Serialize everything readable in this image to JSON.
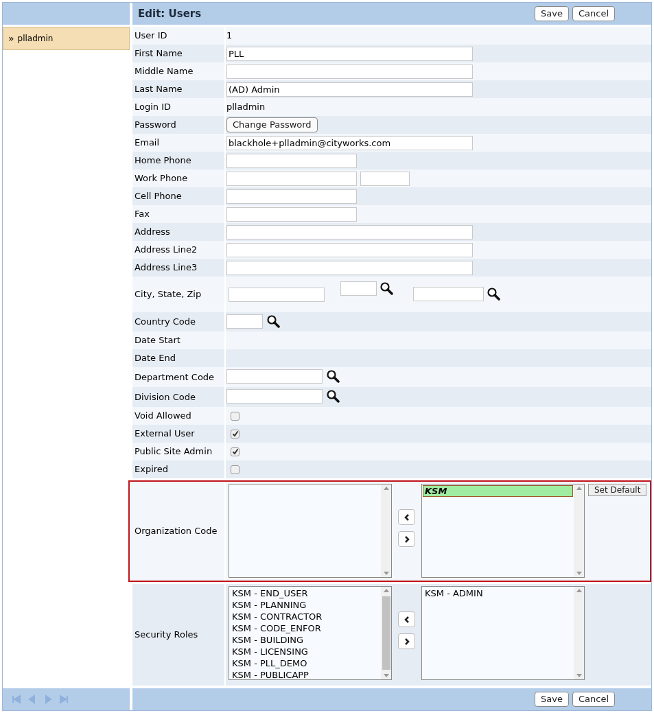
{
  "sidebar": {
    "items": [
      {
        "icon": "»",
        "label": "plladmin",
        "selected": true
      }
    ]
  },
  "header": {
    "title": "Edit: Users",
    "buttons": [
      "Save",
      "Cancel"
    ]
  },
  "fields": [
    {
      "label": "User ID",
      "kind": "text",
      "value": "1"
    },
    {
      "label": "First Name",
      "kind": "input_wide",
      "value": "PLL"
    },
    {
      "label": "Middle Name",
      "kind": "input_wide"
    },
    {
      "label": "Last Name",
      "kind": "input_wide",
      "value": "(AD) Admin"
    },
    {
      "label": "Login ID",
      "kind": "text",
      "value": "plladmin"
    },
    {
      "label": "Password",
      "kind": "button",
      "button": "Change Password"
    },
    {
      "label": "Email",
      "kind": "input_wide",
      "value": "blackhole+plladmin@cityworks.com"
    },
    {
      "label": "Home Phone",
      "kind": "input_short"
    },
    {
      "label": "Work Phone",
      "kind": "phone_ext"
    },
    {
      "label": "Cell Phone",
      "kind": "input_short"
    },
    {
      "label": "Fax",
      "kind": "input_short"
    },
    {
      "label": "Address",
      "kind": "input_wide"
    },
    {
      "label": "Address Line2",
      "kind": "input_wide"
    },
    {
      "label": "Address Line3",
      "kind": "input_wide"
    },
    {
      "label": "City, State, Zip",
      "kind": "city_state_zip"
    },
    {
      "label": "Country Code",
      "kind": "lookup_small"
    },
    {
      "label": "Date Start",
      "kind": "empty"
    },
    {
      "label": "Date End",
      "kind": "empty"
    },
    {
      "label": "Department Code",
      "kind": "lookup"
    },
    {
      "label": "Division Code",
      "kind": "lookup"
    },
    {
      "label": "Void Allowed",
      "kind": "checkbox",
      "checked": false
    },
    {
      "label": "External User",
      "kind": "checkbox",
      "checked": true
    },
    {
      "label": "Public Site Admin",
      "kind": "checkbox",
      "checked": true
    },
    {
      "label": "Expired",
      "kind": "checkbox",
      "checked": false
    },
    {
      "label": "Organization Code",
      "kind": "dual_list",
      "highlighted": true,
      "chosen": [
        {
          "label": "KSM",
          "selected": true
        }
      ],
      "extra_button": "Set Default"
    },
    {
      "label": "Security Roles",
      "kind": "dual_list",
      "highlighted": false,
      "available": [
        {
          "label": "KSM - END_USER"
        },
        {
          "label": "KSM - PLANNING"
        },
        {
          "label": "KSM - CONTRACTOR"
        },
        {
          "label": "KSM - CODE_ENFOR"
        },
        {
          "label": "KSM - BUILDING"
        },
        {
          "label": "KSM - LICENSING"
        },
        {
          "label": "KSM - PLL_DEMO"
        },
        {
          "label": "KSM - PUBLICAPP"
        }
      ],
      "chosen": [
        {
          "label": "KSM - ADMIN",
          "selected": false
        }
      ]
    }
  ],
  "footer": {
    "pager_disabled": true,
    "buttons": [
      "Save",
      "Cancel"
    ]
  }
}
